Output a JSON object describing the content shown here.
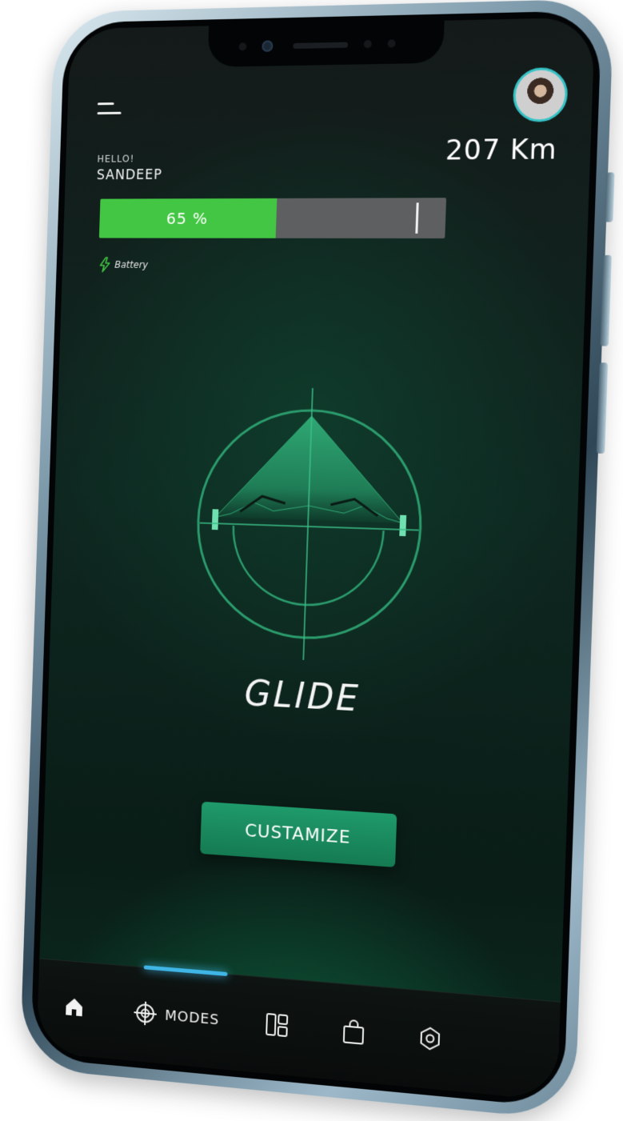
{
  "header": {
    "greeting": "HELLO!",
    "username": "SANDEEP",
    "distance": "207 Km"
  },
  "battery": {
    "percent_label": "65 %",
    "percent_value": 0.65,
    "label": "Battery"
  },
  "mode": {
    "title": "GLIDE",
    "customize_label": "CUSTAMIZE"
  },
  "tabbar": {
    "items": [
      {
        "icon": "home-icon"
      },
      {
        "icon": "crosshair-icon",
        "label": "MODES"
      },
      {
        "icon": "dashboard-icon"
      },
      {
        "icon": "shopping-bag-icon"
      },
      {
        "icon": "settings-hex-icon"
      }
    ]
  },
  "colors": {
    "accent_green": "#43c643",
    "button_green": "#1f9a6a",
    "drone_green": "#2fa874",
    "avatar_ring": "#35c3c6",
    "tab_glow": "#3fb6e6"
  }
}
